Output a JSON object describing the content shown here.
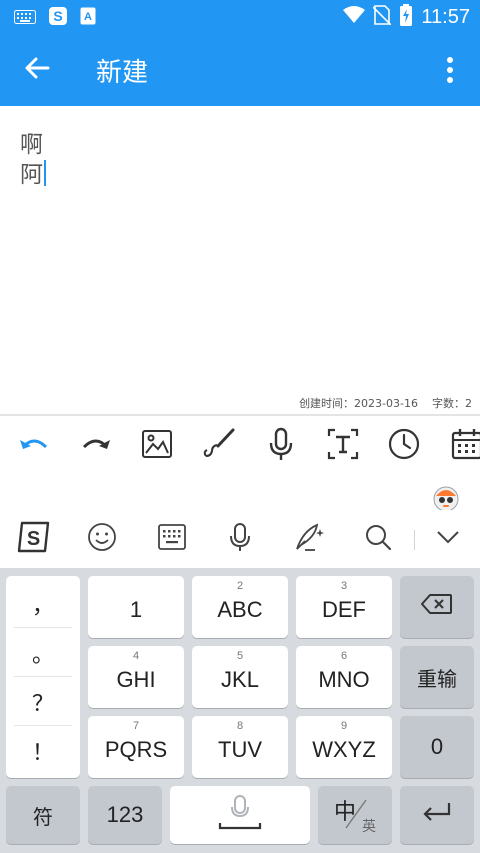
{
  "status_bar": {
    "time": "11:57",
    "left_icons": [
      "keyboard-icon",
      "sogou-icon",
      "text-a-icon"
    ],
    "right_icons": [
      "wifi-icon",
      "no-sim-icon",
      "battery-charging-icon"
    ]
  },
  "app_bar": {
    "title": "新建",
    "back_icon": "arrow-left-icon",
    "menu_icon": "more-vert-icon"
  },
  "editor": {
    "line1": "啊",
    "line2": "阿",
    "created_label": "创建时间：2023-03-16",
    "count_label": "字数：2"
  },
  "toolbar": {
    "items": [
      "undo-icon",
      "redo-icon",
      "image-icon",
      "brush-icon",
      "mic-icon",
      "text-recognize-icon",
      "clock-icon",
      "calendar-icon"
    ]
  },
  "ime_bar": {
    "items": [
      "sogou-logo-icon",
      "emoji-icon",
      "keyboard-layout-icon",
      "voice-icon",
      "quill-icon",
      "search-icon",
      "collapse-icon"
    ]
  },
  "keyboard": {
    "punctuation": [
      "，",
      "。",
      "？",
      "！"
    ],
    "keys": [
      {
        "sub": "",
        "main": "1"
      },
      {
        "sub": "2",
        "main": "ABC"
      },
      {
        "sub": "3",
        "main": "DEF"
      },
      {
        "sub": "4",
        "main": "GHI"
      },
      {
        "sub": "5",
        "main": "JKL"
      },
      {
        "sub": "6",
        "main": "MNO"
      },
      {
        "sub": "7",
        "main": "PQRS"
      },
      {
        "sub": "8",
        "main": "TUV"
      },
      {
        "sub": "9",
        "main": "WXYZ"
      }
    ],
    "reinput": "重输",
    "zero": "0",
    "symbols": "符",
    "numbers": "123",
    "lang_main": "中",
    "lang_sub": "英",
    "colors": {
      "accent": "#2196f3",
      "background": "#d7dbe0",
      "key": "#ffffff",
      "key_dark": "#c3c8cf"
    }
  }
}
